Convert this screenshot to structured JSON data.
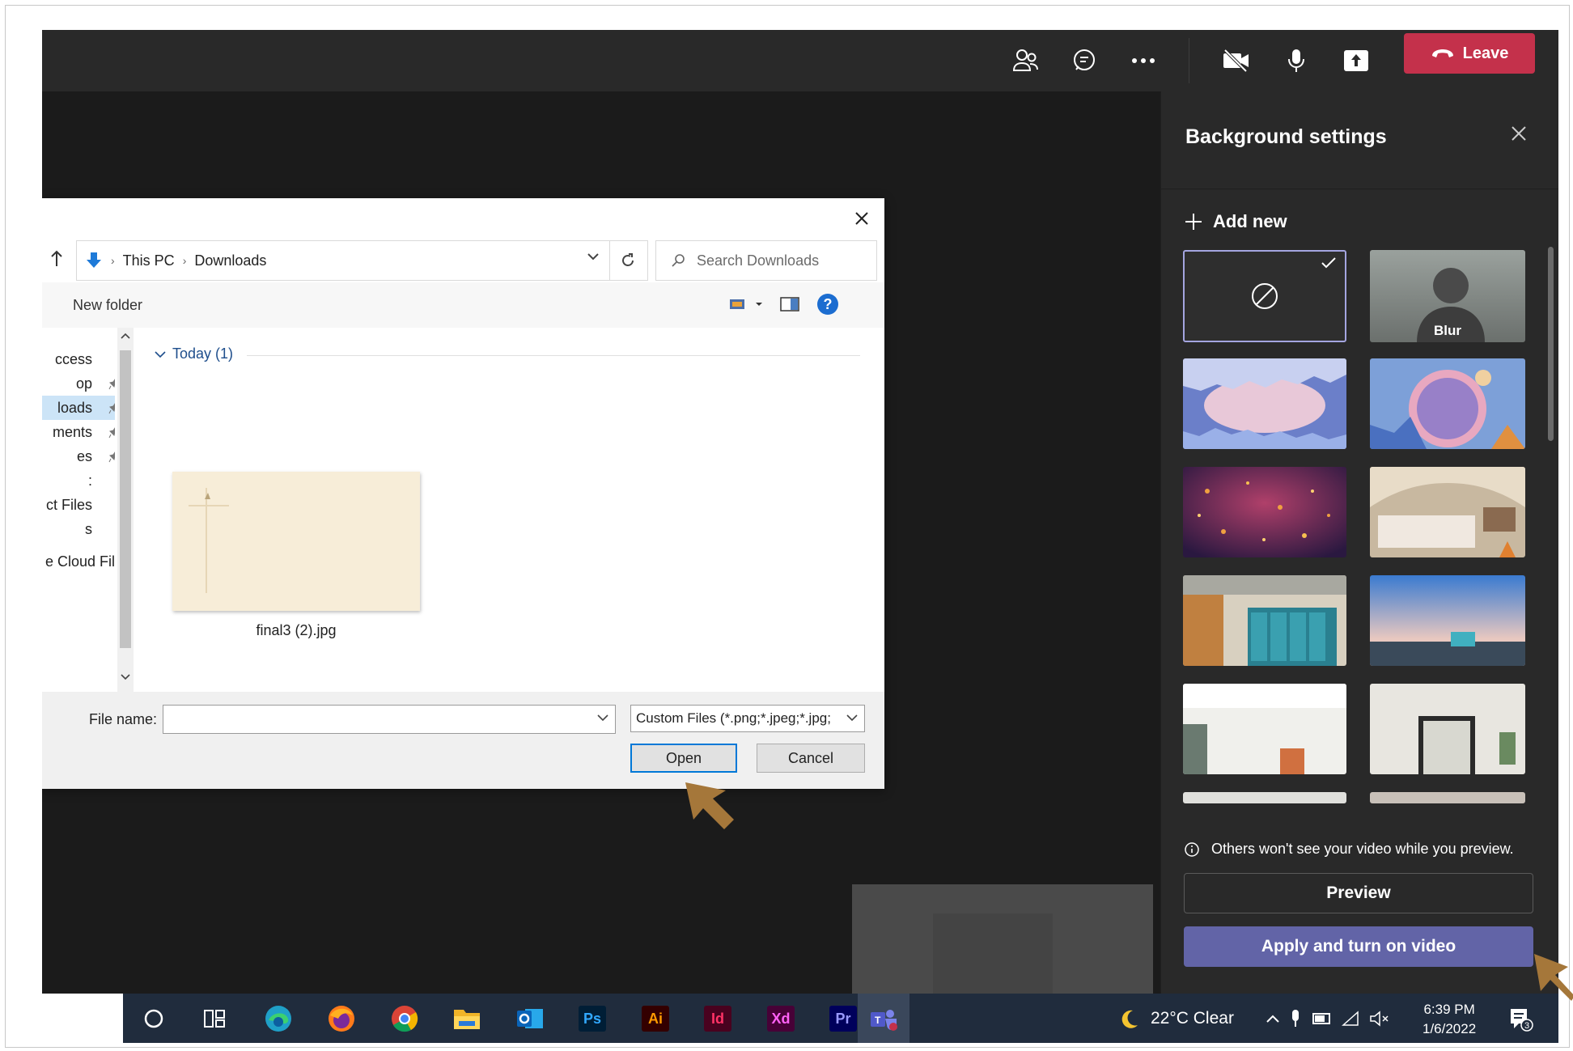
{
  "teams": {
    "leave_label": "Leave",
    "topbar_icons": [
      "people-icon",
      "chat-icon",
      "more-icon",
      "camera-off-icon",
      "microphone-icon",
      "share-icon"
    ]
  },
  "background_panel": {
    "title": "Background settings",
    "add_new_label": "Add new",
    "blur_label": "Blur",
    "note": "Others won't see your video while you preview.",
    "preview_label": "Preview",
    "apply_label": "Apply and turn on video"
  },
  "file_dialog": {
    "breadcrumb": [
      "This PC",
      "Downloads"
    ],
    "search_placeholder": "Search Downloads",
    "new_folder_label": "New folder",
    "nav_items": [
      {
        "label": "ccess",
        "pinned": false,
        "selected": false
      },
      {
        "label": "op",
        "pinned": true,
        "selected": false
      },
      {
        "label": "loads",
        "pinned": true,
        "selected": true
      },
      {
        "label": "ments",
        "pinned": true,
        "selected": false
      },
      {
        "label": "es",
        "pinned": true,
        "selected": false
      },
      {
        "label": ":",
        "pinned": false,
        "selected": false
      },
      {
        "label": "ct Files",
        "pinned": false,
        "selected": false
      },
      {
        "label": "s",
        "pinned": false,
        "selected": false
      },
      {
        "label": "e Cloud File",
        "pinned": false,
        "selected": false
      }
    ],
    "group_header": "Today (1)",
    "file_name": "final3 (2).jpg",
    "file_name_label": "File name:",
    "file_name_value": "",
    "filter_label": "Custom Files (*.png;*.jpeg;*.jpg;",
    "open_label": "Open",
    "cancel_label": "Cancel"
  },
  "taskbar": {
    "apps": [
      "search-icon",
      "task-view-icon",
      "edge-icon",
      "firefox-icon",
      "chrome-icon",
      "file-explorer-icon",
      "outlook-icon",
      "photoshop-icon",
      "illustrator-icon",
      "indesign-icon",
      "xd-icon",
      "premiere-icon",
      "teams-icon"
    ],
    "photoshop": "Ps",
    "illustrator": "Ai",
    "indesign": "Id",
    "xd": "Xd",
    "premiere": "Pr",
    "weather": "22°C  Clear",
    "time": "6:39 PM",
    "date": "1/6/2022",
    "notification_count": "3"
  },
  "colors": {
    "leave": "#c4314b",
    "apply": "#6264a7",
    "teams_dark": "#292929",
    "dialog_accent": "#0078d7",
    "cursor": "#a5773a"
  }
}
